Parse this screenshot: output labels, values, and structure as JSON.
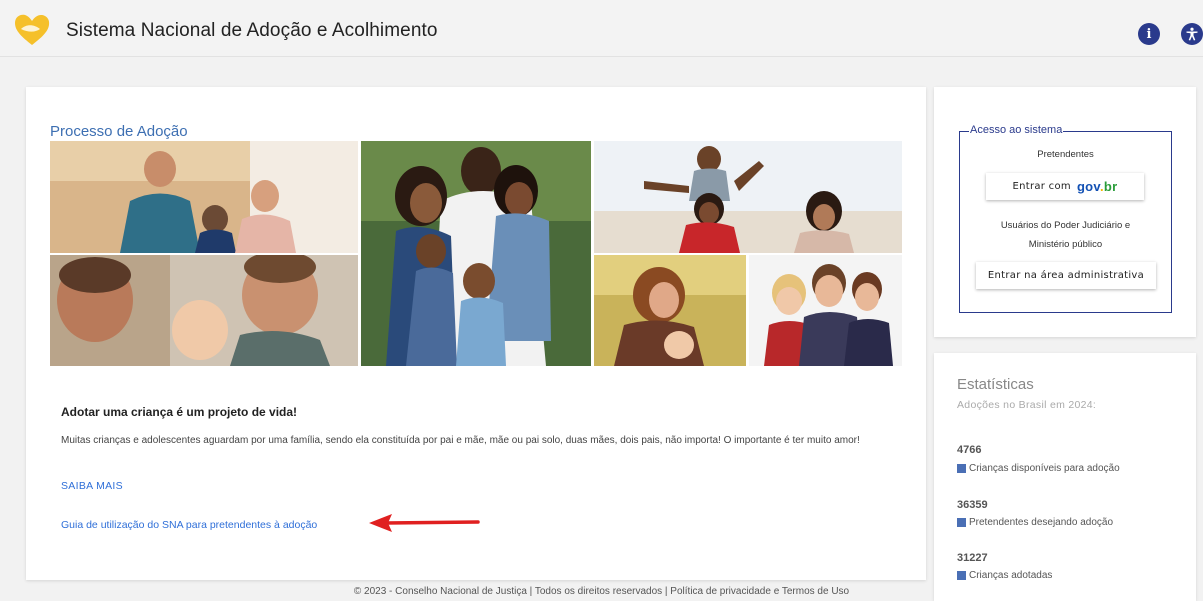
{
  "header": {
    "title": "Sistema Nacional de Adoção e Acolhimento",
    "logo_icon": "heart-logo-icon",
    "info_icon_glyph": "i",
    "accessibility_icon": "accessibility-icon",
    "brand_color": "#f5c02a",
    "accent_color": "#2a3a8c"
  },
  "main": {
    "section_title": "Processo de Adoção",
    "headline": "Adotar uma criança é um projeto de vida!",
    "body": "Muitas crianças e adolescentes aguardam por uma família, sendo ela constituída por pai e mãe, mãe ou pai solo, duas mães, dois pais, não importa! O importante é ter muito amor!",
    "saiba_mais": "SAIBA MAIS",
    "guide_link": "Guia de utilização do SNA para pretendentes à adoção"
  },
  "access": {
    "legend": "Acesso ao sistema",
    "pretendentes_label": "Pretendentes",
    "gov_button_prefix": "Entrar com",
    "gov_logo": {
      "part1": "gov",
      "part2": ".",
      "part3": "br"
    },
    "judiciary_label_line1": "Usuários do Poder Judiciário e",
    "judiciary_label_line2": "Ministério público",
    "admin_button": "Entrar na área administrativa"
  },
  "stats": {
    "title": "Estatísticas",
    "subtitle": "Adoções no Brasil em 2024:",
    "items": [
      {
        "value": "4766",
        "label": "Crianças disponíveis para adoção"
      },
      {
        "value": "36359",
        "label": "Pretendentes desejando adoção"
      },
      {
        "value": "31227",
        "label": "Crianças adotadas"
      }
    ]
  },
  "footer": {
    "text": "© 2023 - Conselho Nacional de Justiça | Todos os direitos reservados | Política de privacidade e Termos de Uso"
  }
}
